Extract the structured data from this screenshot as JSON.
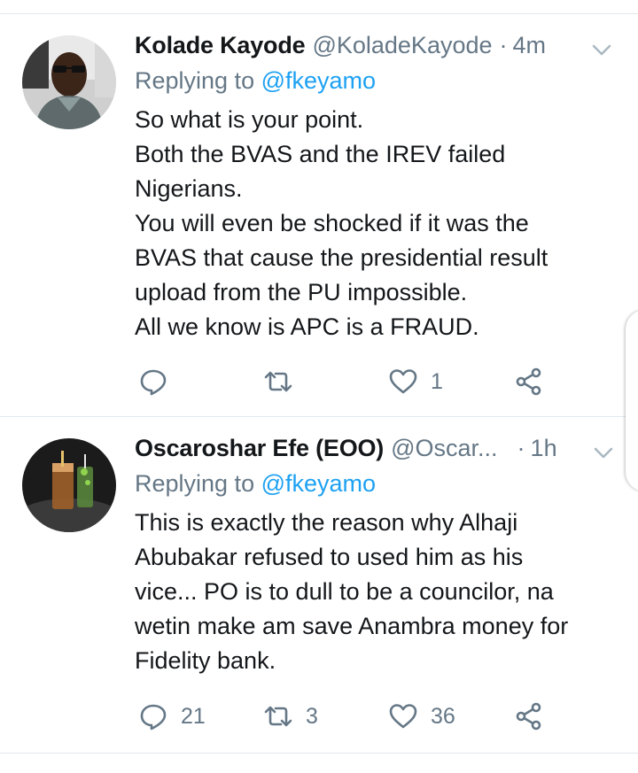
{
  "tweets": [
    {
      "name": "Kolade Kayode",
      "handle": "@KoladeKayode",
      "separator": "·",
      "time": "4m",
      "replying_prefix": "Replying to ",
      "replying_to": "@fkeyamo",
      "lines": [
        "So what is your point.",
        "Both the BVAS and the IREV failed",
        "Nigerians.",
        "You will even be shocked if it was the",
        "BVAS that cause the presidential result",
        "upload from the PU impossible.",
        "All we know is APC is a FRAUD."
      ],
      "actions": {
        "reply_count": "",
        "retweet_count": "",
        "like_count": "1"
      }
    },
    {
      "name": "Oscaroshar Efe (EOO)",
      "handle": "@Oscar...",
      "separator": "·",
      "time": "1h",
      "replying_prefix": "Replying to ",
      "replying_to": "@fkeyamo",
      "lines": [
        "This is exactly the reason why Alhaji",
        "Abubakar refused to used him as his",
        "vice... PO is to dull to be a councilor, na",
        "wetin make am save Anambra money for",
        "Fidelity bank."
      ],
      "actions": {
        "reply_count": "21",
        "retweet_count": "3",
        "like_count": "36"
      }
    }
  ],
  "colors": {
    "text": "#14171a",
    "secondary": "#657786",
    "link": "#1da1f2",
    "divider": "#e1e8ed"
  },
  "icons": [
    "reply-icon",
    "retweet-icon",
    "like-icon",
    "share-icon",
    "chevron-down-icon"
  ]
}
